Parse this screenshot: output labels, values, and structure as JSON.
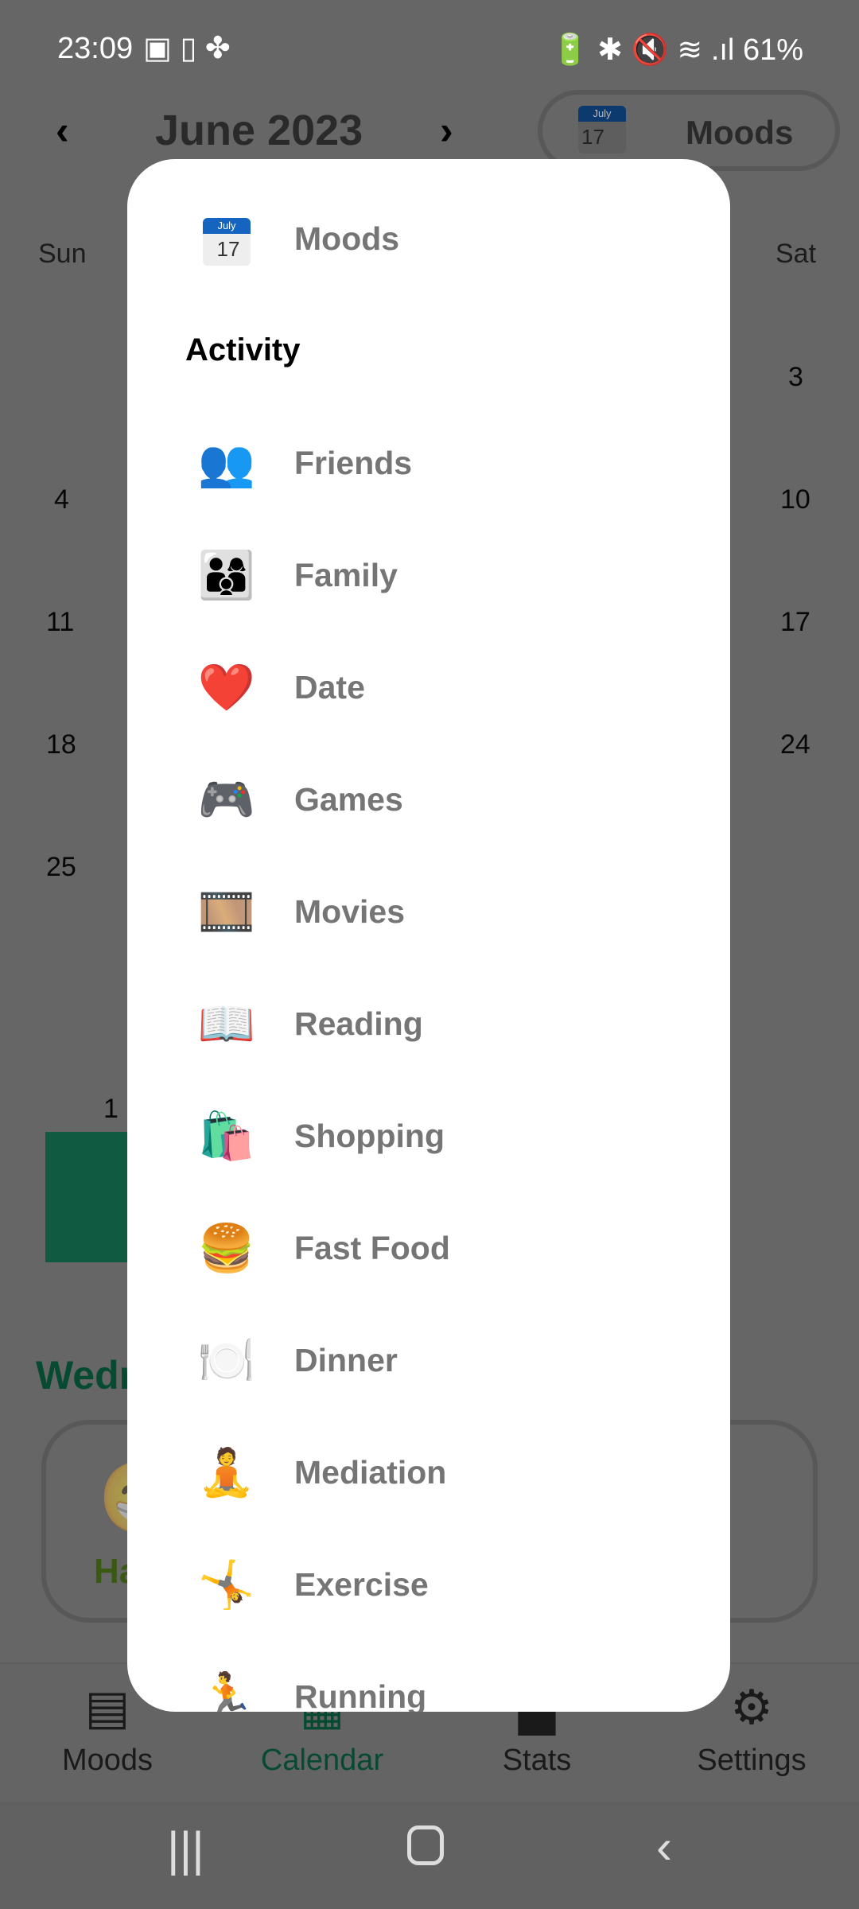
{
  "status_bar": {
    "time": "23:09",
    "battery": "61%",
    "icons": [
      "image-icon",
      "phone-lock-icon",
      "fan-icon",
      "battery-saver-icon",
      "bluetooth-icon",
      "mute-icon",
      "wifi-icon",
      "volte-icon",
      "signal-icon",
      "battery-icon"
    ]
  },
  "header": {
    "month": "June 2023",
    "view_toggle": {
      "label": "Moods",
      "icon_month": "July",
      "icon_day": "17"
    }
  },
  "calendar": {
    "weekdays_visible": [
      "Sun",
      "Sat"
    ],
    "sunday_dates": [
      "4",
      "11",
      "18",
      "25"
    ],
    "saturday_dates": [
      "3",
      "10",
      "17",
      "24"
    ],
    "bar_count": "1",
    "accent": "#1a9e6e"
  },
  "day_detail": {
    "title_partial": "Wedn",
    "mood_partial": "Ha"
  },
  "bottom_nav": [
    {
      "label": "Moods",
      "icon": "list-icon"
    },
    {
      "label": "Calendar",
      "icon": "calendar-icon",
      "active": true
    },
    {
      "label": "Stats",
      "icon": "bar-chart-icon"
    },
    {
      "label": "Settings",
      "icon": "gear-icon"
    }
  ],
  "menu": {
    "top_item": {
      "label": "Moods",
      "icon_month": "July",
      "icon_day": "17"
    },
    "section": "Activity",
    "items": [
      {
        "label": "Friends",
        "emoji": "👥"
      },
      {
        "label": "Family",
        "emoji": "👨‍👩‍👦"
      },
      {
        "label": "Date",
        "emoji": "❤️"
      },
      {
        "label": "Games",
        "emoji": "🎮"
      },
      {
        "label": "Movies",
        "emoji": "🎞️"
      },
      {
        "label": "Reading",
        "emoji": "📖"
      },
      {
        "label": "Shopping",
        "emoji": "🛍️"
      },
      {
        "label": "Fast Food",
        "emoji": "🍔"
      },
      {
        "label": "Dinner",
        "emoji": "🍽️"
      },
      {
        "label": "Mediation",
        "emoji": "🧘"
      },
      {
        "label": "Exercise",
        "emoji": "🤸"
      },
      {
        "label": "Running",
        "emoji": "🏃"
      }
    ]
  }
}
